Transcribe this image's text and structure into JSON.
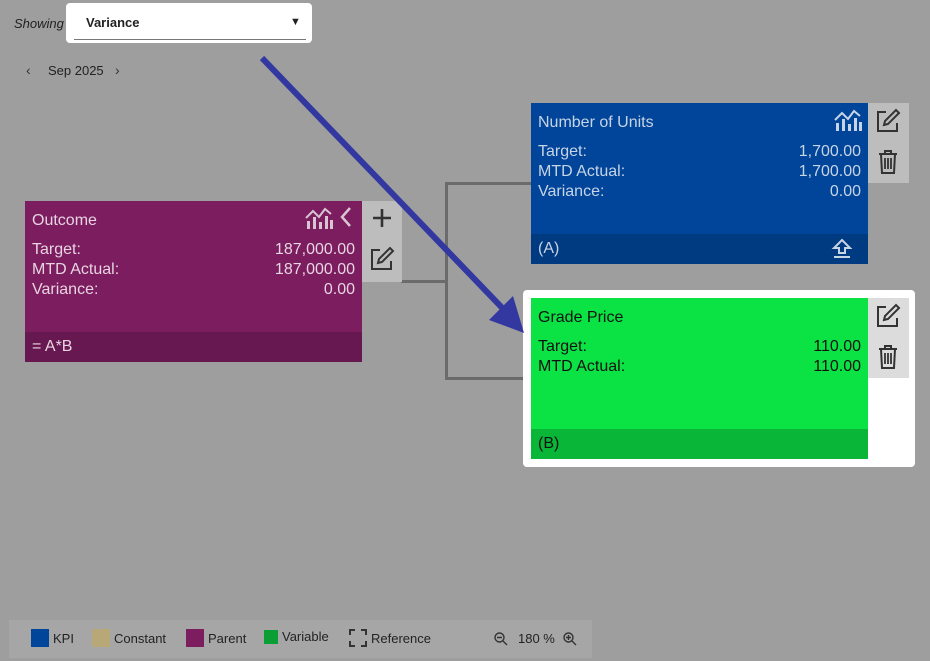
{
  "header": {
    "showing_label": "Showing",
    "dropdown_value": "Variance",
    "dropdown_caret": "▼",
    "month": "Sep 2025",
    "prev_glyph": "‹",
    "next_glyph": "›"
  },
  "cards": {
    "outcome": {
      "title": "Outcome",
      "rows": [
        {
          "label": "Target:",
          "value": "187,000.00"
        },
        {
          "label": "MTD Actual:",
          "value": "187,000.00"
        },
        {
          "label": "Variance:",
          "value": "0.00"
        }
      ],
      "footer": "= A*B",
      "color": "#7b1d5e",
      "footer_color": "#671850",
      "text_color": "#e8d4e2"
    },
    "units": {
      "title": "Number of Units",
      "rows": [
        {
          "label": "Target:",
          "value": "1,700.00"
        },
        {
          "label": "MTD Actual:",
          "value": "1,700.00"
        },
        {
          "label": "Variance:",
          "value": "0.00"
        }
      ],
      "footer": "(A)",
      "color": "#004599",
      "footer_color": "#003a80",
      "text_color": "#c7d4e6"
    },
    "grade": {
      "title": "Grade Price",
      "rows": [
        {
          "label": "Target:",
          "value": "110.00"
        },
        {
          "label": "MTD Actual:",
          "value": "110.00"
        }
      ],
      "footer": "(B)",
      "color": "#0be243",
      "footer_color": "#0ab638",
      "text_color": "#111111"
    }
  },
  "icons": {
    "chart": "chart-icon",
    "collapse": "chevron-left-icon",
    "add": "plus-icon",
    "edit": "edit-icon",
    "delete": "trash-icon",
    "upload": "upload-icon",
    "zoom_out": "zoom-out-icon",
    "zoom_in": "zoom-in-icon"
  },
  "legend": {
    "items": [
      {
        "label": "KPI",
        "color": "#004599"
      },
      {
        "label": "Constant",
        "color": "#b8a878"
      },
      {
        "label": "Parent",
        "color": "#7b1d5e"
      },
      {
        "label": "Variable",
        "color": "#0a9e35"
      },
      {
        "label": "Reference",
        "color": "none"
      }
    ],
    "zoom": "180 %"
  },
  "accent": {
    "arrow": "#3238a0",
    "highlight": "#ffffff"
  }
}
